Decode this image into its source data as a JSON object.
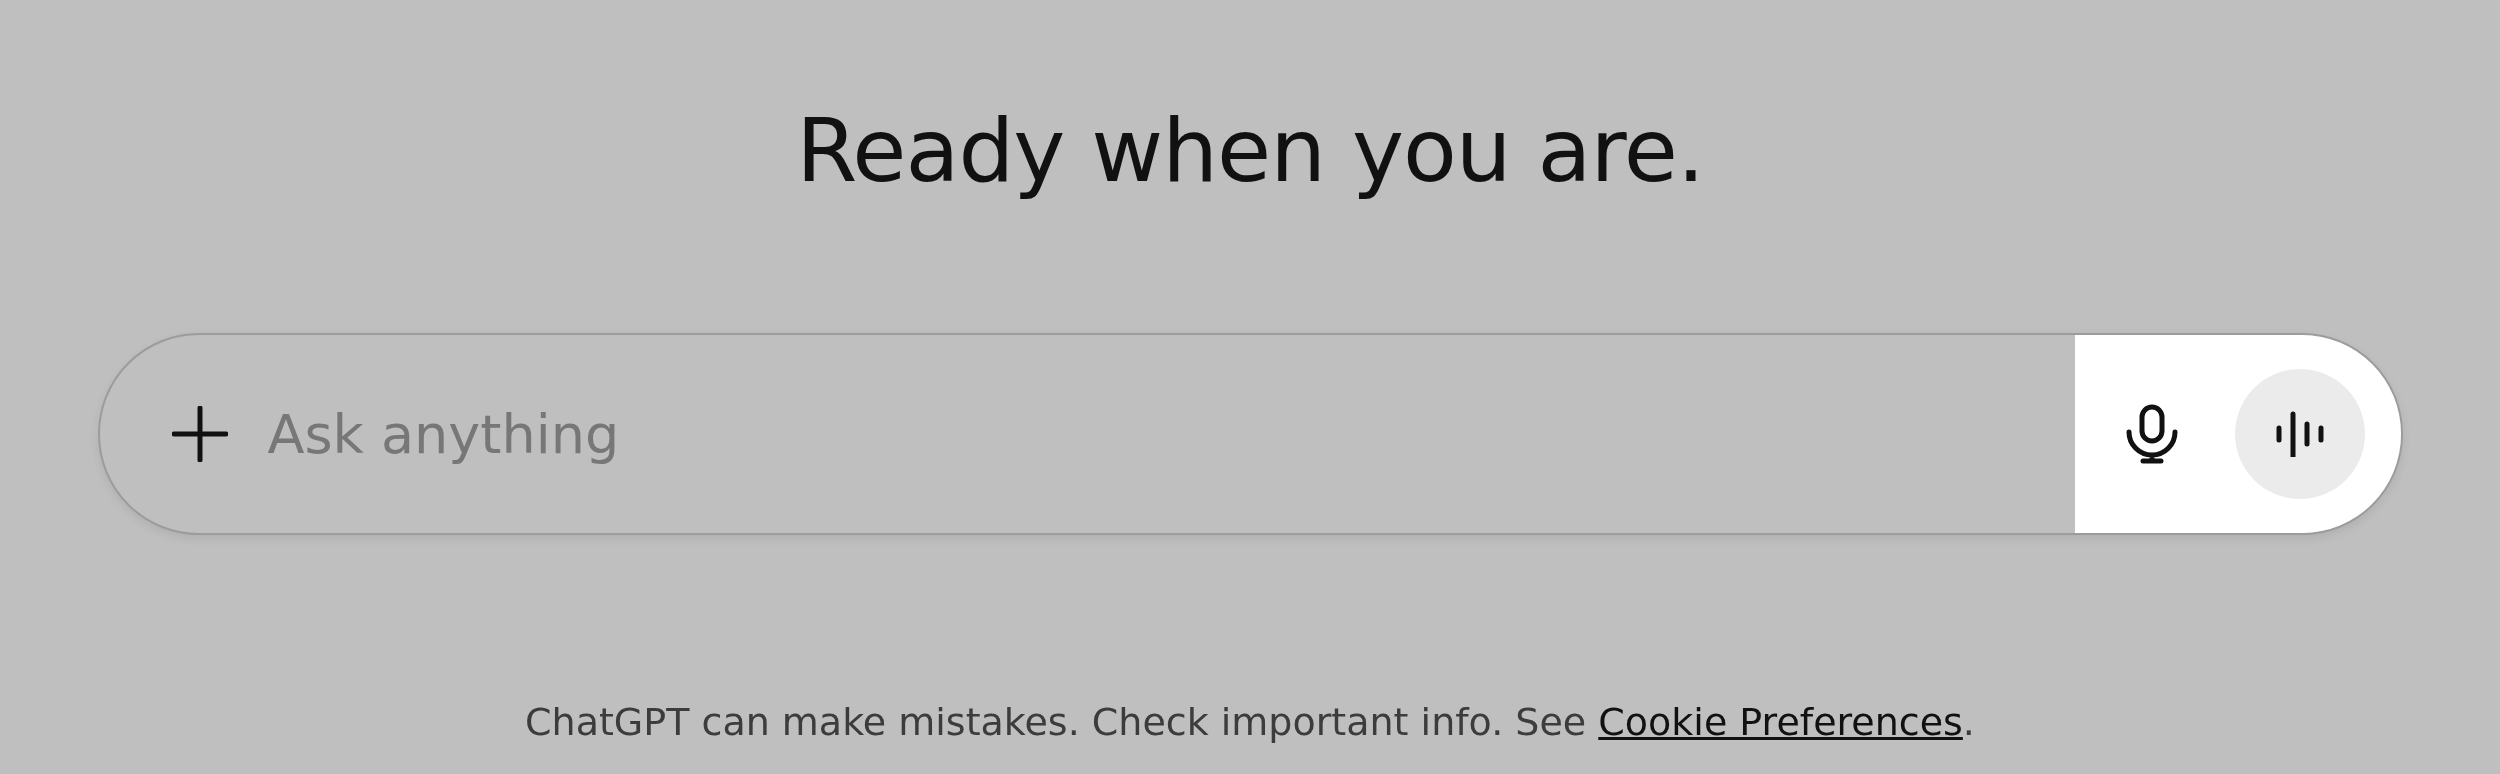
{
  "heading": "Ready when you are.",
  "composer": {
    "placeholder": "Ask anything"
  },
  "disclaimer": {
    "text": "ChatGPT can make mistakes. Check important info. See ",
    "link": "Cookie Preferences",
    "suffix": "."
  }
}
